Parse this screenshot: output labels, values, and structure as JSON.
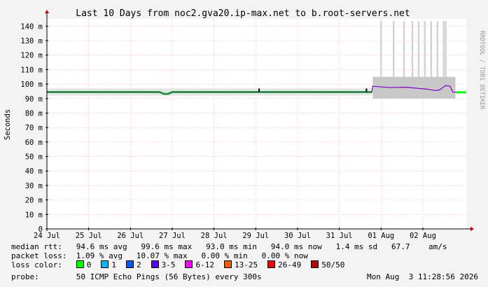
{
  "chart_data": {
    "type": "line",
    "title": "Last 10 Days from noc2.gva20.ip-max.net to b.root-servers.net",
    "ylabel": "Seconds",
    "watermark": "RRDTOOL / TOBI OETIKER",
    "ylim": [
      0,
      145
    ],
    "yticks": [
      0,
      10,
      20,
      30,
      40,
      50,
      60,
      70,
      80,
      90,
      100,
      110,
      120,
      130,
      140
    ],
    "ytick_labels": [
      "0",
      "10 m",
      "20 m",
      "30 m",
      "40 m",
      "50 m",
      "60 m",
      "70 m",
      "80 m",
      "90 m",
      "100 m",
      "110 m",
      "120 m",
      "130 m",
      "140 m"
    ],
    "xlim": [
      0,
      10.04
    ],
    "xticks": [
      0,
      1,
      2,
      3,
      4,
      5,
      6,
      7,
      8,
      9
    ],
    "xtick_labels": [
      "24 Jul",
      "25 Jul",
      "26 Jul",
      "27 Jul",
      "28 Jul",
      "29 Jul",
      "30 Jul",
      "31 Jul",
      "01 Aug",
      "02 Aug"
    ],
    "grid": true,
    "series": [
      {
        "name": "median rtt",
        "x": [
          0,
          2.7,
          2.8,
          2.9,
          3.0,
          7.78,
          7.8,
          8.2,
          8.6,
          8.9,
          9.1,
          9.3,
          9.4,
          9.55,
          9.65,
          9.72,
          9.8,
          10.04
        ],
        "values": [
          94.5,
          94.5,
          93.2,
          93.2,
          94.5,
          94.5,
          98.5,
          97.6,
          97.8,
          97.0,
          96.5,
          95.5,
          96.0,
          99.0,
          98.5,
          94.5,
          94.3,
          94.3
        ]
      }
    ],
    "smoke": {
      "base": [
        [
          0,
          92,
          97
        ],
        [
          7.78,
          92,
          97
        ]
      ],
      "x_start": 7.8,
      "x_end": 9.78,
      "low": 90,
      "high": 105,
      "spikes": [
        8.0,
        8.3,
        8.55,
        8.75,
        8.9,
        9.05,
        9.2,
        9.35,
        9.5,
        9.55
      ]
    },
    "loss_marks": [
      5.08,
      7.65
    ]
  },
  "stats": {
    "median_rtt": "median rtt:   94.6 ms avg   99.6 ms max   93.0 ms min   94.0 ms now   1.4 ms sd   67.7    am/s",
    "packet_loss": "packet loss:  1.09 % avg   10.07 % max   0.00 % min   0.00 % now",
    "loss_color_label": "loss color:",
    "probe_label": "probe:",
    "probe_text": "50 ICMP Echo Pings (56 Bytes) every 300s",
    "timestamp": "Mon Aug  3 11:28:56 2026"
  },
  "loss_colors": [
    {
      "label": "0",
      "color": "#00ff00"
    },
    {
      "label": "1",
      "color": "#00b8ff"
    },
    {
      "label": "2",
      "color": "#0059ff"
    },
    {
      "label": "3-5",
      "color": "#5e00ff"
    },
    {
      "label": "6-12",
      "color": "#ff00ff"
    },
    {
      "label": "13-25",
      "color": "#ff5900"
    },
    {
      "label": "26-49",
      "color": "#ff0000"
    },
    {
      "label": "50/50",
      "color": "#b80000"
    }
  ],
  "colors": {
    "grid": "#ff9999",
    "axis": "#000000",
    "median": "#7d00c0",
    "smoke": "#c8c8c8",
    "arrow": "#b00000"
  }
}
